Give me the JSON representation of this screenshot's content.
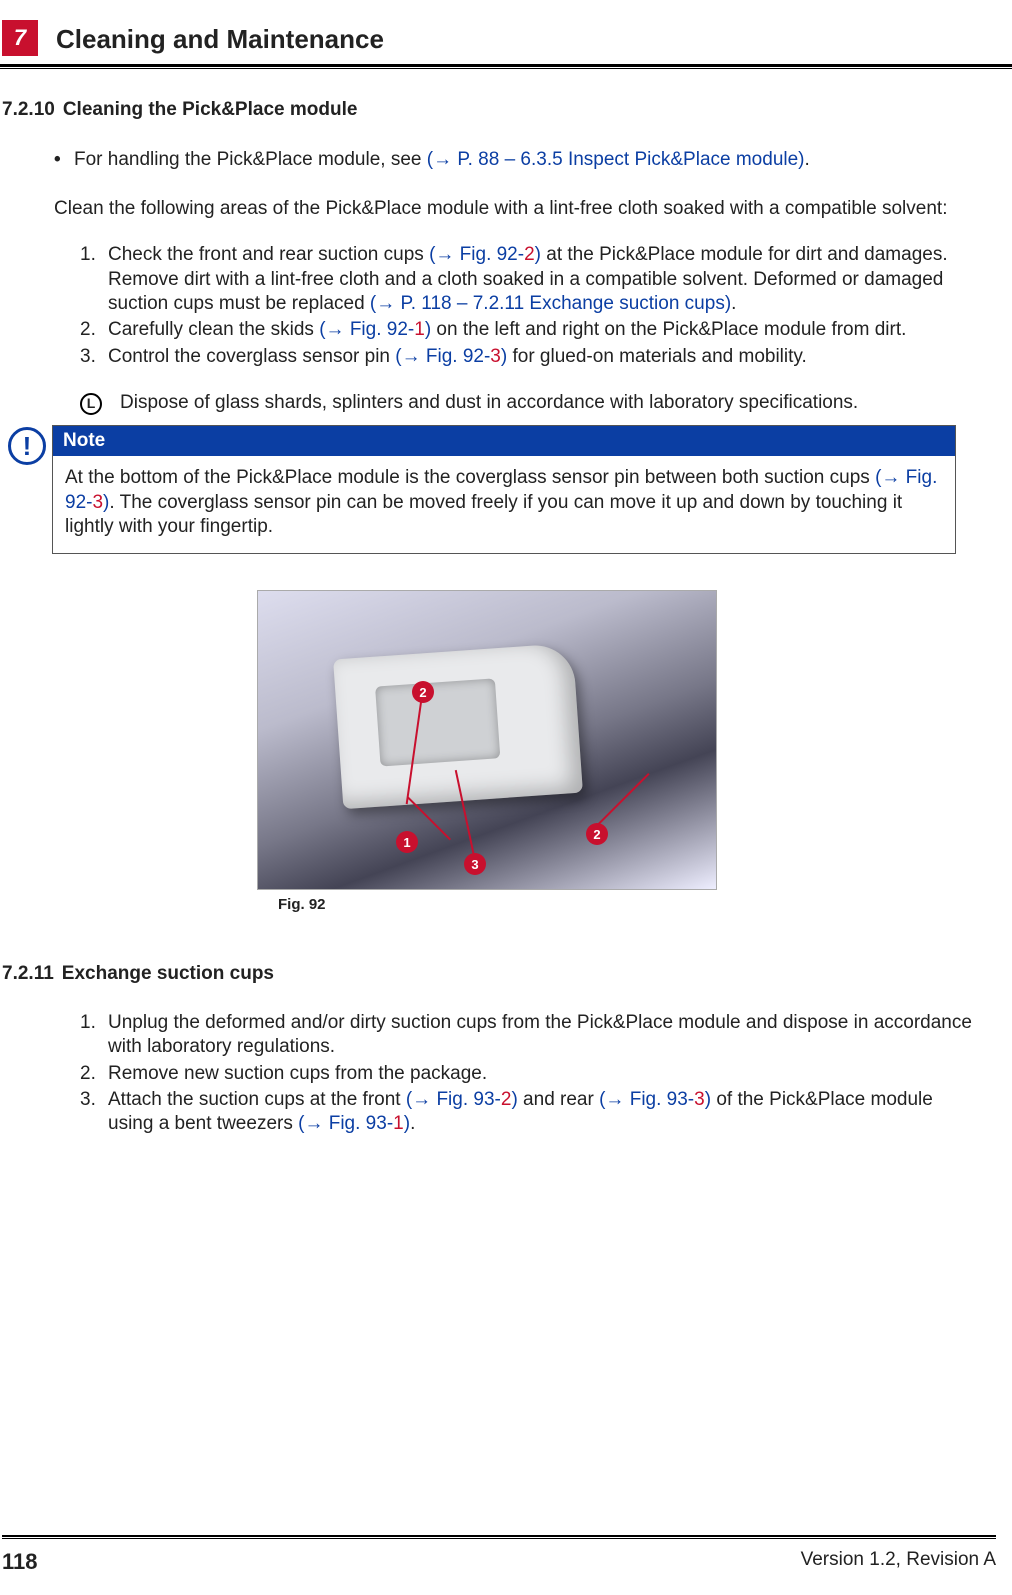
{
  "header": {
    "chapter_number": "7",
    "chapter_title": "Cleaning and Maintenance"
  },
  "section_7210": {
    "number": "7.2.10",
    "title": "Cleaning the Pick&Place module",
    "bullet_prefix": "For handling the Pick&Place module, see ",
    "bullet_link": "(→ P. 88 – 6.3.5 Inspect Pick&Place module)",
    "bullet_suffix": ".",
    "intro": "Clean the following areas of the Pick&Place module with a lint-free cloth soaked with a compatible solvent:",
    "step1_a": "Check the front and rear suction cups ",
    "step1_link1_a": "(→ Fig.  92‑",
    "step1_link1_num": "2",
    "step1_link1_b": ")",
    "step1_b": " at the Pick&Place module for dirt and damages. Remove dirt with a lint-free cloth and a cloth soaked in a compatible solvent. Deformed or damaged suction cups must be replaced ",
    "step1_link2": "(→ P. 118 – 7.2.11 Exchange suction cups)",
    "step1_c": ".",
    "step2_a": "Carefully clean the skids ",
    "step2_link_a": "(→ Fig.  92‑",
    "step2_link_num": "1",
    "step2_link_b": ")",
    "step2_b": " on the left and right on the Pick&Place module from dirt.",
    "step3_a": "Control the coverglass sensor pin ",
    "step3_link_a": "(→ Fig.  92‑",
    "step3_link_num": "3",
    "step3_link_b": ")",
    "step3_b": " for glued-on materials and mobility.",
    "info_text": "Dispose of glass shards, splinters and dust in accordance with laboratory specifications."
  },
  "note": {
    "label": "Note",
    "body_a": "At the bottom of the Pick&Place module is the coverglass sensor pin between both suction cups ",
    "body_link_a": "(→ Fig.  92‑",
    "body_link_num": "3",
    "body_link_b": ")",
    "body_b": ". The coverglass sensor pin can be moved freely if you can move it up and down by touching it lightly with your fingertip."
  },
  "figure92": {
    "callout1": "1",
    "callout2a": "2",
    "callout2b": "2",
    "callout3": "3",
    "caption": "Fig.  92"
  },
  "section_7211": {
    "number": "7.2.11",
    "title": "Exchange suction cups",
    "step1": "Unplug the deformed and/or dirty suction cups from the Pick&Place module and dispose in accordance with laboratory regulations.",
    "step2": "Remove new suction cups from the package.",
    "step3_a": "Attach the suction cups at the front ",
    "step3_link1_a": "(→ Fig.  93‑",
    "step3_link1_num": "2",
    "step3_link1_b": ")",
    "step3_b": " and rear ",
    "step3_link2_a": "(→ Fig.  93‑",
    "step3_link2_num": "3",
    "step3_link2_b": ")",
    "step3_c": " of the Pick&Place module using a bent tweezers ",
    "step3_link3_a": "(→ Fig.  93‑",
    "step3_link3_num": "1",
    "step3_link3_b": ")",
    "step3_d": "."
  },
  "footer": {
    "page": "118",
    "version": "Version 1.2, Revision A"
  }
}
